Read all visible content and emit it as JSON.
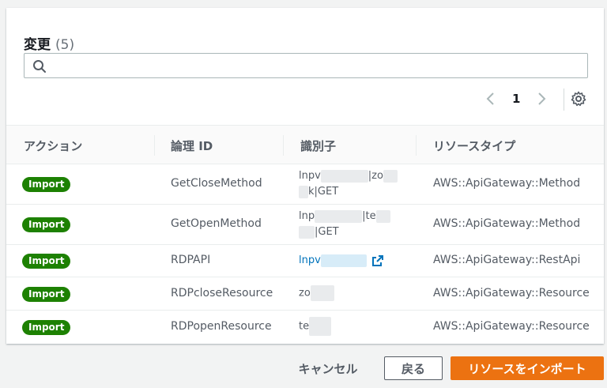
{
  "header": {
    "title": "変更",
    "count": "(5)"
  },
  "search": {
    "placeholder": "",
    "value": ""
  },
  "pagination": {
    "current_page": "1"
  },
  "table": {
    "columns": [
      "アクション",
      "論理 ID",
      "識別子",
      "リソースタイプ"
    ],
    "rows": [
      {
        "action": "Import",
        "logical_id": "GetCloseMethod",
        "identifier_line1_start": "lnpv",
        "identifier_line1_end": "|zo",
        "identifier_line2_end": "k|GET",
        "resource_type": "AWS::ApiGateway::Method"
      },
      {
        "action": "Import",
        "logical_id": "GetOpenMethod",
        "identifier_line1_start": "lnp",
        "identifier_line1_end": "|te",
        "identifier_line2_end": "|GET",
        "resource_type": "AWS::ApiGateway::Method"
      },
      {
        "action": "Import",
        "logical_id": "RDPAPI",
        "identifier_line1_start": "lnpv",
        "identifier_line1_end": "",
        "identifier_line2_end": "",
        "resource_type": "AWS::ApiGateway::RestApi"
      },
      {
        "action": "Import",
        "logical_id": "RDPcloseResource",
        "identifier_line1_start": "zo",
        "identifier_line1_end": "",
        "identifier_line2_end": "",
        "resource_type": "AWS::ApiGateway::Resource"
      },
      {
        "action": "Import",
        "logical_id": "RDPopenResource",
        "identifier_line1_start": "te",
        "identifier_line1_end": "",
        "identifier_line2_end": "",
        "resource_type": "AWS::ApiGateway::Resource"
      }
    ]
  },
  "footer": {
    "cancel_label": "キャンセル",
    "back_label": "戻る",
    "import_label": "リソースをインポート"
  },
  "colors": {
    "badge_green": "#1d8102",
    "primary_orange": "#ec7211",
    "link_blue": "#0073bb"
  }
}
